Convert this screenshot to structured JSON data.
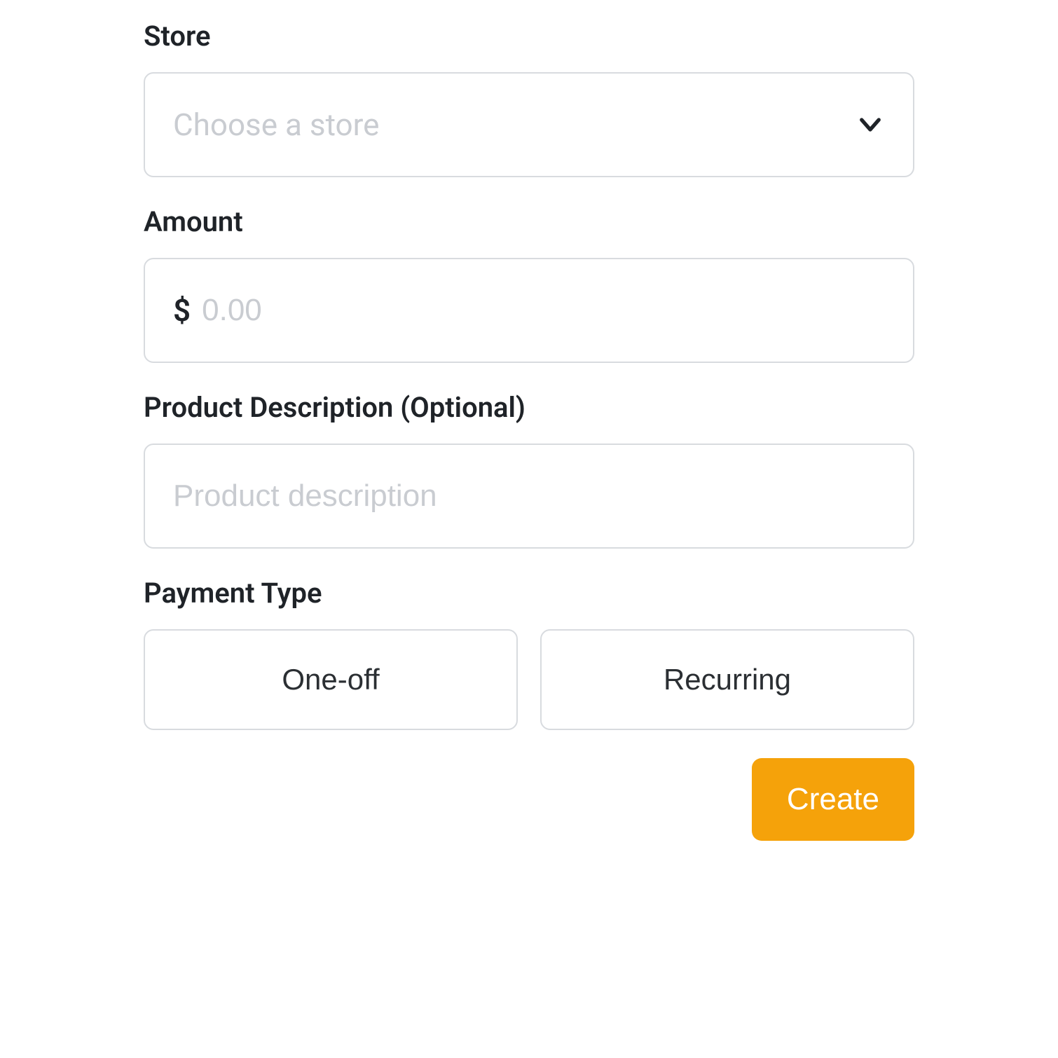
{
  "form": {
    "store": {
      "label": "Store",
      "placeholder": "Choose a store"
    },
    "amount": {
      "label": "Amount",
      "currency_symbol": "$",
      "placeholder": "0.00"
    },
    "description": {
      "label": "Product Description (Optional)",
      "placeholder": "Product description"
    },
    "payment_type": {
      "label": "Payment Type",
      "options": {
        "one_off": "One-off",
        "recurring": "Recurring"
      }
    },
    "submit_label": "Create"
  },
  "colors": {
    "accent": "#f5a20a",
    "border": "#d8dbdf",
    "placeholder": "#c9ccd1",
    "text": "#1f2328"
  }
}
